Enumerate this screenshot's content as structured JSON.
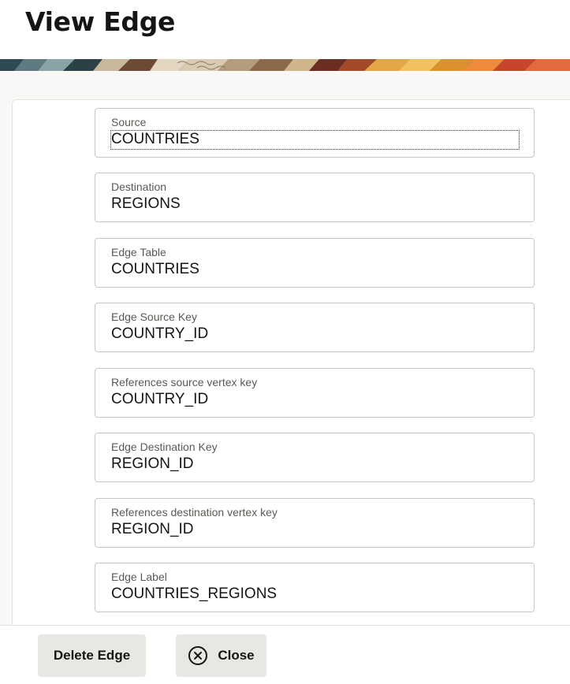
{
  "dialog": {
    "title": "View Edge"
  },
  "fields": [
    {
      "label": "Source",
      "value": "COUNTRIES"
    },
    {
      "label": "Destination",
      "value": "REGIONS"
    },
    {
      "label": "Edge Table",
      "value": "COUNTRIES"
    },
    {
      "label": "Edge Source Key",
      "value": "COUNTRY_ID"
    },
    {
      "label": "References source vertex key",
      "value": "COUNTRY_ID"
    },
    {
      "label": "Edge Destination Key",
      "value": "REGION_ID"
    },
    {
      "label": "References destination vertex key",
      "value": "REGION_ID"
    },
    {
      "label": "Edge Label",
      "value": "COUNTRIES_REGIONS"
    }
  ],
  "footer": {
    "delete_label": "Delete Edge",
    "close_label": "Close",
    "close_icon": "circle-x-icon"
  }
}
